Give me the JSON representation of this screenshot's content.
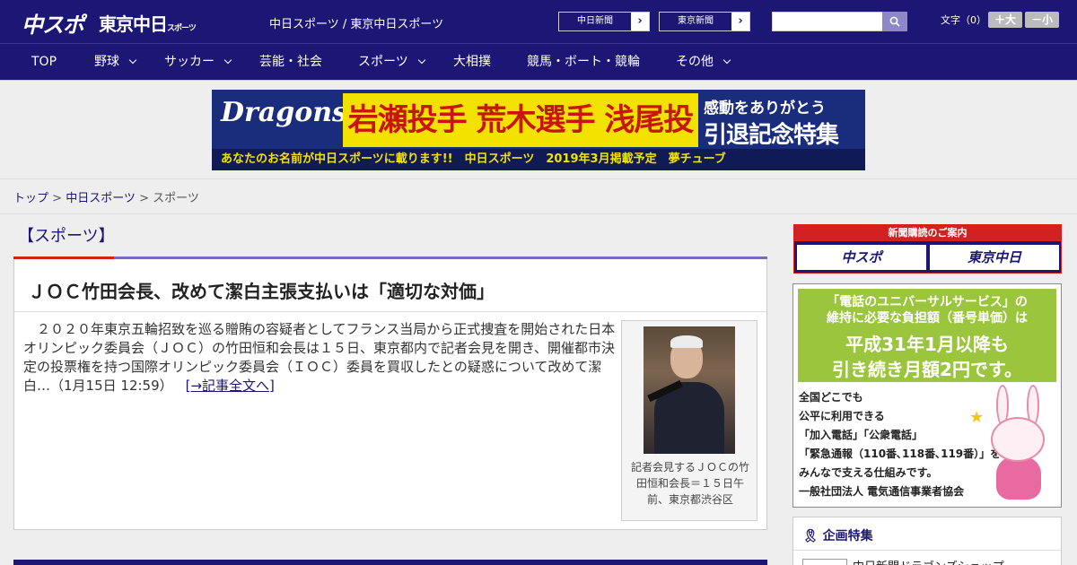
{
  "header": {
    "logo": "中スポ",
    "logo2": "東京中日",
    "logo2_sub": "スポーツ",
    "site_name": "中日スポーツ / 東京中日スポーツ",
    "paper_buttons": [
      {
        "label": "中日新聞",
        "arrow": "›"
      },
      {
        "label": "東京新聞",
        "arrow": "›"
      }
    ],
    "search_placeholder": "",
    "font_size_label": "文字（0）",
    "font_larger": "＋大",
    "font_smaller": "－小"
  },
  "nav": [
    {
      "label": "TOP",
      "dropdown": false
    },
    {
      "label": "野球",
      "dropdown": true
    },
    {
      "label": "サッカー",
      "dropdown": true
    },
    {
      "label": "芸能・社会",
      "dropdown": false
    },
    {
      "label": "スポーツ",
      "dropdown": true
    },
    {
      "label": "大相撲",
      "dropdown": false
    },
    {
      "label": "競馬・ボート・競輪",
      "dropdown": false
    },
    {
      "label": "その他",
      "dropdown": true
    }
  ],
  "banner": {
    "team": "Dragons",
    "players": "岩瀬投手 荒木選手 浅尾投手",
    "thanks": "感動をありがとう",
    "tokushu": "引退記念特集",
    "strip": "あなたのお名前が中日スポーツに載ります!!　中日スポーツ　2019年3月掲載予定　夢チューブ"
  },
  "breadcrumb": {
    "top": "トップ",
    "sep1": " > ",
    "chunichi": "中日スポーツ",
    "sep2": " > ",
    "current": "スポーツ"
  },
  "section": {
    "title": "【スポーツ】"
  },
  "article": {
    "headline": "ＪＯＣ竹田会長、改めて潔白主張支払いは「適切な対価」",
    "body": "　２０２０年東京五輪招致を巡る贈賄の容疑者としてフランス当局から正式捜査を開始された日本オリンピック委員会（ＪＯＣ）の竹田恒和会長は１５日、東京都内で記者会見を開き、開催都市決定の投票権を持つ国際オリンピック委員会（ＩＯＣ）委員を買収したとの疑惑について改めて潔白…（1月15日 12:59）",
    "read_more": "[→記事全文へ]",
    "caption": "記者会見するＪＯＣの竹田恒和会長＝１５日午前、東京都渋谷区"
  },
  "sidebar": {
    "subscribe_title": "新聞購読のご案内",
    "subscribe_buttons": [
      "中スポ",
      "東京中日"
    ],
    "ad": {
      "line1": "「電話のユニバーサルサービス」の",
      "line2": "維持に必要な負担額（番号単価）は",
      "line3": "平成31年1月以降も",
      "line4": "引き続き月額2円です。",
      "body_lines": [
        "全国どこでも",
        "公平に利用できる",
        "「加入電話」「公衆電話」",
        "「緊急通報（110番､118番､119番）」を",
        "みんなで支える仕組みです。"
      ],
      "org": "一般社団法人 電気通信事業者協会"
    },
    "feature_title": "企画特集",
    "feature_item": "中日新聞ドラゴンズショップ"
  }
}
